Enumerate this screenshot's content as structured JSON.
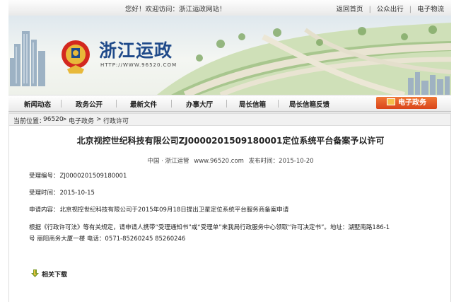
{
  "topbar": {
    "welcome": "您好！欢迎访问：浙江运政网站！",
    "links": [
      "返回首页",
      "公众出行",
      "电子物流"
    ]
  },
  "banner": {
    "site_title": "浙江运政",
    "site_url": "HTTP://WWW.96520.COM"
  },
  "nav": {
    "items": [
      "新闻动态",
      "政务公开",
      "最新文件",
      "办事大厅",
      "局长信箱",
      "局长信箱反馈"
    ],
    "egov_button": "电子政务"
  },
  "breadcrumb": {
    "prefix": "当前位置：",
    "items": [
      "96520",
      "电子政务",
      "行政许可"
    ],
    "sep": ">"
  },
  "article": {
    "title": "北京视控世纪科技有限公司ZJ0000201509180001定位系统平台备案予以许可",
    "source": "中国 · 浙江运管",
    "url": "www.96520.com",
    "date_label": "发布时间：",
    "date": "2015-10-20",
    "accept_no_label": "受理编号：",
    "accept_no": "ZJ0000201509180001",
    "accept_time_label": "受理时间：",
    "accept_time": "2015-10-15",
    "apply_label": "申请内容：",
    "apply_content": "北京视控世纪科技有限公司于2015年09月18日提出卫星定位系统平台服务商备案申请",
    "notice_line1": "根据《行政许可法》等有关规定，请申请人携带“受理通知书”或“受理单”来我局行政服务中心领取“许可决定书”。地址：湖墅南路186-1",
    "notice_line2": "号 丽阳商务大厦一楼 电话：0571-85260245 85260246",
    "download_label": "相关下载"
  },
  "colors": {
    "egov_button": "#e05a22",
    "title_blue": "#1f4a8a"
  }
}
